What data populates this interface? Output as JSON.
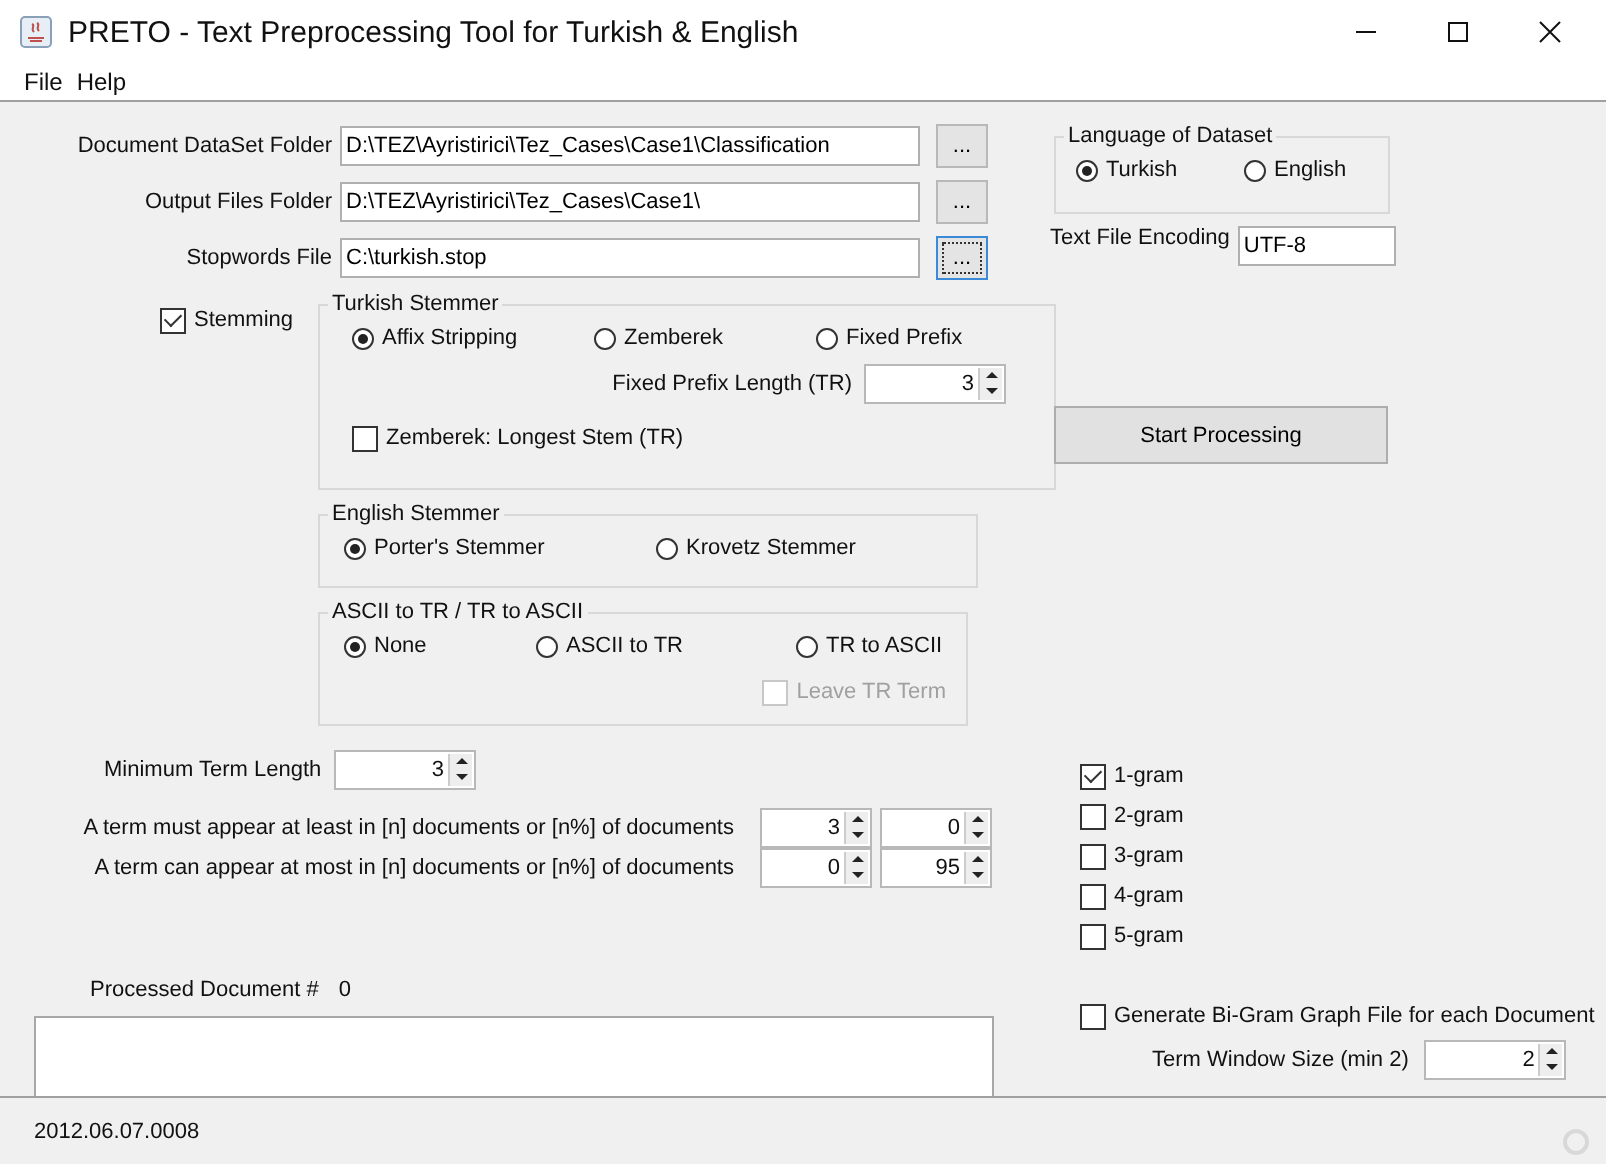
{
  "window": {
    "title": "PRETO - Text Preprocessing Tool for Turkish & English"
  },
  "menu": [
    "File",
    "Help"
  ],
  "paths": [
    {
      "label": "Document DataSet Folder",
      "value": "D:\\TEZ\\Ayristirici\\Tez_Cases\\Case1\\Classification",
      "button": "...",
      "focused": false
    },
    {
      "label": "Output Files Folder",
      "value": "D:\\TEZ\\Ayristirici\\Tez_Cases\\Case1\\",
      "button": "...",
      "focused": false
    },
    {
      "label": "Stopwords File",
      "value": "C:\\turkish.stop",
      "button": "...",
      "focused": true
    }
  ],
  "stemming": {
    "label": "Stemming",
    "checked": true
  },
  "turkish_stemmer": {
    "title": "Turkish Stemmer",
    "options": [
      {
        "label": "Affix Stripping",
        "selected": true
      },
      {
        "label": "Zemberek",
        "selected": false
      },
      {
        "label": "Fixed Prefix",
        "selected": false
      }
    ],
    "prefix_length": {
      "label": "Fixed Prefix Length (TR)",
      "value": "3"
    },
    "longest_stem": {
      "label": "Zemberek: Longest Stem (TR)",
      "checked": false
    }
  },
  "english_stemmer": {
    "title": "English Stemmer",
    "options": [
      {
        "label": "Porter's Stemmer",
        "selected": true
      },
      {
        "label": "Krovetz Stemmer",
        "selected": false
      }
    ]
  },
  "ascii": {
    "title": "ASCII to TR / TR to ASCII",
    "options": [
      {
        "label": "None",
        "selected": true
      },
      {
        "label": "ASCII to TR",
        "selected": false
      },
      {
        "label": "TR to ASCII",
        "selected": false
      }
    ],
    "leave_tr_term": {
      "label": "Leave TR Term",
      "checked": false,
      "disabled": true
    }
  },
  "min_term_length": {
    "label": "Minimum Term Length",
    "value": "3"
  },
  "term_rules": [
    {
      "label": "A term must appear at least in [n] documents or [n%] of documents",
      "n": "3",
      "percent": "0"
    },
    {
      "label": "A term can appear at most in [n] documents or [n%] of documents",
      "n": "0",
      "percent": "95"
    }
  ],
  "processed": {
    "label": "Processed Document #",
    "value": "0"
  },
  "language": {
    "title": "Language of Dataset",
    "options": [
      {
        "label": "Turkish",
        "selected": true
      },
      {
        "label": "English",
        "selected": false
      }
    ]
  },
  "encoding": {
    "label": "Text File Encoding",
    "value": "UTF-8"
  },
  "start_button": "Start Processing",
  "ngrams": [
    {
      "label": "1-gram",
      "checked": true
    },
    {
      "label": "2-gram",
      "checked": false
    },
    {
      "label": "3-gram",
      "checked": false
    },
    {
      "label": "4-gram",
      "checked": false
    },
    {
      "label": "5-gram",
      "checked": false
    }
  ],
  "bigram_graph": {
    "label": "Generate Bi-Gram Graph File for each Document",
    "checked": false
  },
  "term_window": {
    "label": "Term Window Size (min 2)",
    "value": "2"
  },
  "status_bar": {
    "version": "2012.06.07.0008"
  }
}
